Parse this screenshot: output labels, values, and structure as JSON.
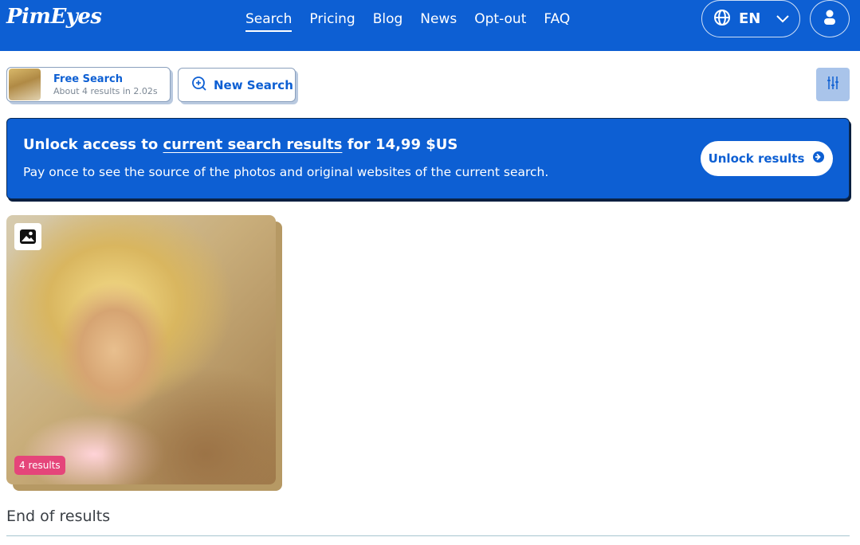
{
  "header": {
    "logo": "PimEyes",
    "nav": [
      "Search",
      "Pricing",
      "Blog",
      "News",
      "Opt-out",
      "FAQ"
    ],
    "active_nav": "Search",
    "language": "EN"
  },
  "search_info": {
    "title": "Free Search",
    "subtitle": "About 4 results in 2.02s",
    "new_search_label": "New Search"
  },
  "banner": {
    "heading_prefix": "Unlock access to ",
    "heading_link": "current search results",
    "heading_suffix": " for 14,99 $US",
    "description": "Pay once to see the source of the photos and original websites of the current search.",
    "button_label": "Unlock results"
  },
  "result": {
    "badge": "4 results"
  },
  "footer": {
    "end_text": "End of results"
  },
  "colors": {
    "brand_blue": "#0d5fd3",
    "badge_pink": "#e5457a",
    "filter_bg": "#a9c4ea"
  },
  "icons": [
    "globe-icon",
    "chevron-down-icon",
    "user-icon",
    "search-plus-icon",
    "filter-icon",
    "arrow-right-circle-icon",
    "image-icon"
  ]
}
